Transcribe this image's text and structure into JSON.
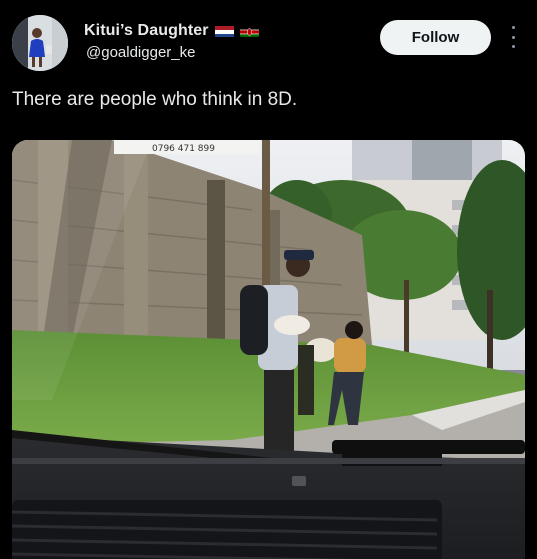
{
  "author": {
    "display_name": "Kitui’s Daughter",
    "handle": "@goaldigger_ke",
    "flags": [
      "netherlands-flag",
      "kenya-flag"
    ]
  },
  "actions": {
    "follow_label": "Follow",
    "more_icon": "more-vertical-icon"
  },
  "tweet": {
    "text": "There are people who think in 8D."
  },
  "media": {
    "sign_text": "0796 471 899",
    "description_icon": "photo"
  },
  "colors": {
    "background": "#000000",
    "text": "#e7e9ea",
    "follow_bg": "#eff3f4",
    "follow_text": "#0f1419"
  }
}
